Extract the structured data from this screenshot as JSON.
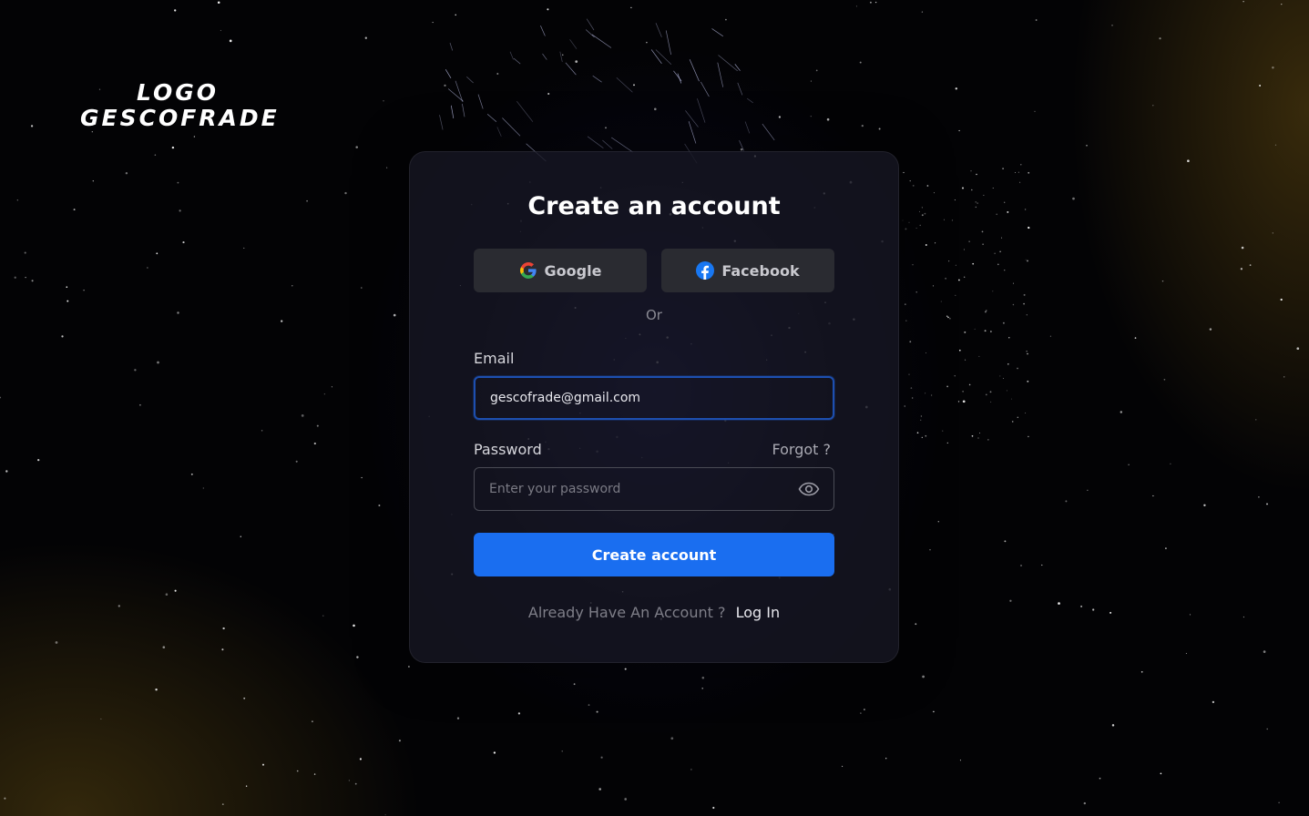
{
  "brand": {
    "logo_line1": "LOGO",
    "logo_line2": "GESCOFRADE"
  },
  "form": {
    "title": "Create an account",
    "social": {
      "google_label": "Google",
      "google_icon": "google-icon",
      "facebook_label": "Facebook",
      "facebook_icon": "facebook-icon"
    },
    "divider_text": "Or",
    "email": {
      "label": "Email",
      "value": "gescofrade@gmail.com"
    },
    "password": {
      "label": "Password",
      "placeholder": "Enter your password",
      "forgot_label": "Forgot ?",
      "toggle_icon": "eye-icon"
    },
    "submit_label": "Create account",
    "footer": {
      "question": "Already Have An Account ?",
      "login_label": "Log In"
    }
  },
  "colors": {
    "accent": "#1a6ef0",
    "focus_border": "#1d4fb0",
    "card_bg": "#16162a",
    "social_btn_bg": "#2a2b31"
  }
}
